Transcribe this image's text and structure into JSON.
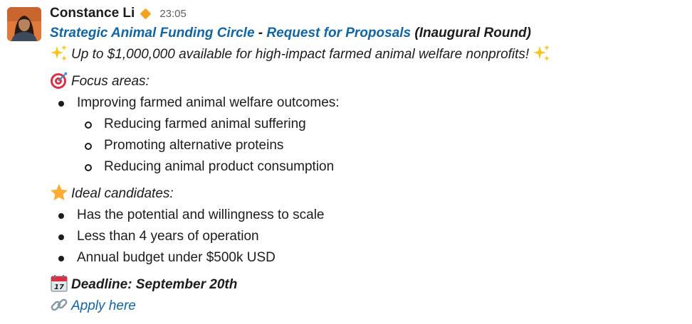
{
  "message": {
    "sender": "Constance Li",
    "timestamp": "23:05",
    "badge_icon": "orange-diamond",
    "title_link1": "Strategic Animal Funding Circle",
    "title_separator": " - ",
    "title_link2": "Request for Proposals",
    "title_suffix": " (Inaugural Round)",
    "intro": "Up to $1,000,000 available for high-impact farmed animal welfare nonprofits!",
    "focus_heading": "Focus areas:",
    "focus_items": [
      "Improving farmed animal welfare outcomes:"
    ],
    "focus_subitems": [
      "Reducing farmed animal suffering",
      "Promoting alternative proteins",
      "Reducing animal product consumption"
    ],
    "candidates_heading": "Ideal candidates:",
    "candidates_items": [
      "Has the potential and willingness to scale",
      "Less than 4 years of operation",
      "Annual budget under $500k USD"
    ],
    "deadline": "Deadline: September 20th",
    "apply_link": "Apply here"
  },
  "colors": {
    "link": "#1264a3",
    "text": "#1d1c1d",
    "timestamp": "#616061",
    "badge": "#f2a31b"
  }
}
